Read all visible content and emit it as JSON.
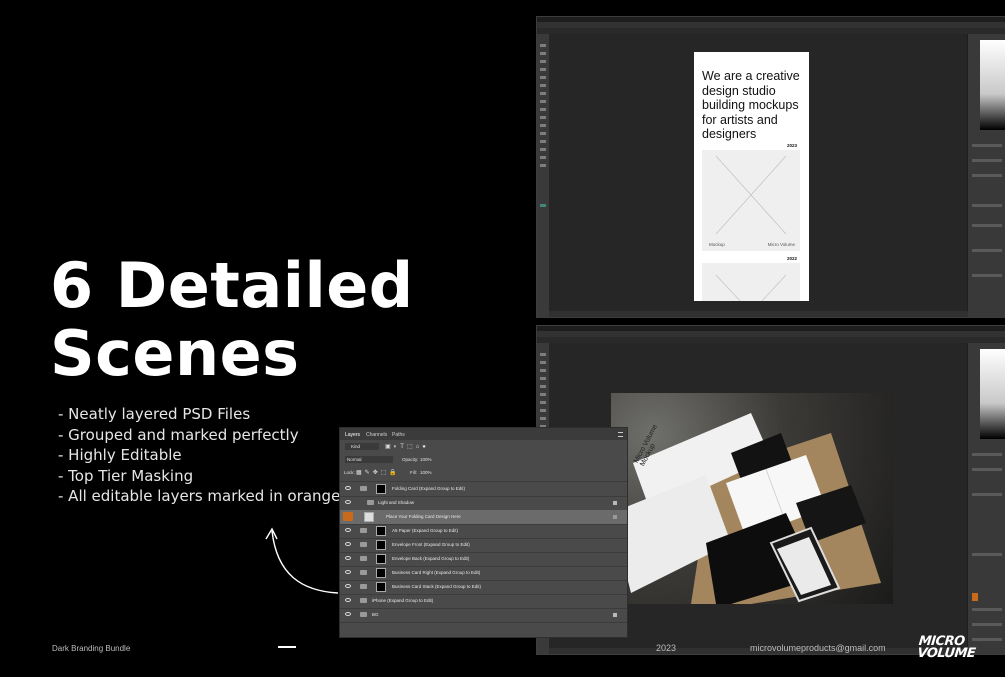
{
  "hero": {
    "headline_line1": "6 Detailed",
    "headline_line2": "Scenes",
    "bullets": [
      "- Neatly layered PSD Files",
      "- Grouped and marked perfectly",
      "- Highly Editable",
      "- Top Tier Masking",
      "- All editable layers marked in orange"
    ]
  },
  "footer": {
    "left": "Dark Branding Bundle",
    "year": "2023",
    "email": "microvolumeproducts@gmail.com",
    "logo_line1": "MICRO",
    "logo_line2": "VOLUME"
  },
  "document1": {
    "headline": "We are a creative design studio building mockups for artists and designers",
    "year1": "2023",
    "caption_left": "Mockup",
    "caption_right": "Micro Volume",
    "year2": "2022"
  },
  "document2": {
    "brand_text": "Micro Volume Mockup"
  },
  "layers_panel": {
    "tabs": [
      "Layers",
      "Channels",
      "Paths"
    ],
    "filter": "Kind",
    "blend_mode": "Normal",
    "opacity_label": "Opacity:",
    "opacity_value": "100%",
    "lock_label": "Lock:",
    "fill_label": "Fill:",
    "fill_value": "100%",
    "layers": [
      "Folding Card (Expand Group to Edit)",
      "Light and Shadow",
      "Place Your Folding Card Design Here",
      "A5 Paper (Expand Group to Edit)",
      "Envelope Front (Expand Group to Edit)",
      "Envelope Back (Expand Group to Edit)",
      "Business Card Right (Expand Group to Edit)",
      "Business Card Stack (Expand Group to Edit)",
      "iPhone (Expand Group to Edit)",
      "BG"
    ],
    "accent_color": "#c86a1a"
  }
}
